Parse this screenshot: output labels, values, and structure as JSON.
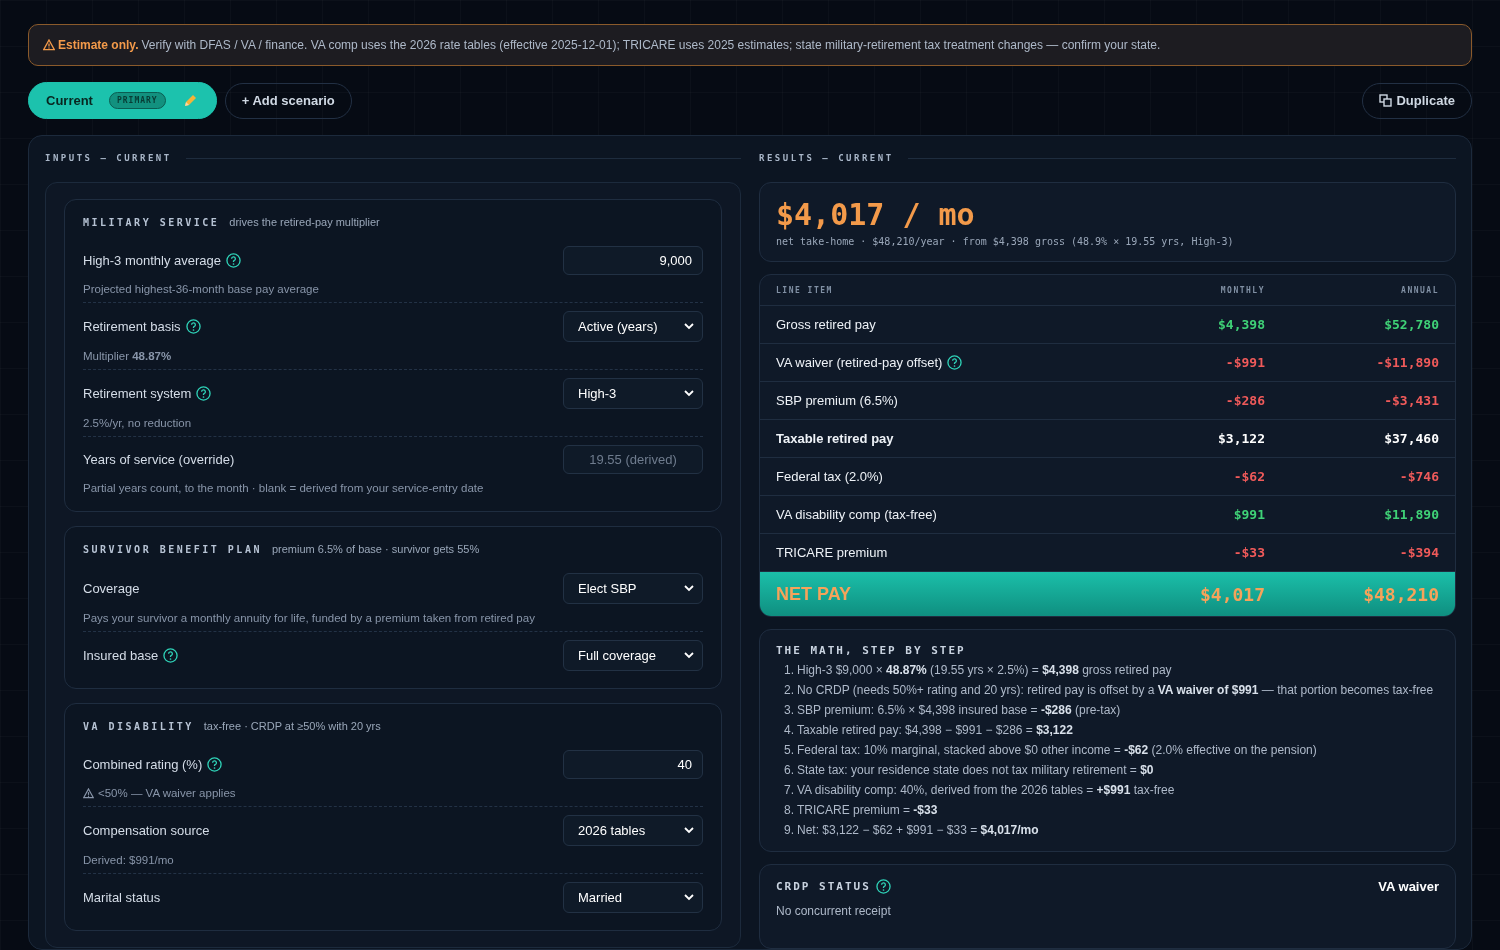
{
  "banner": {
    "lead": "Estimate only.",
    "text": "Verify with DFAS / VA / finance. VA comp uses the 2026 rate tables (effective 2025-12-01); TRICARE uses 2025 estimates; state military-retirement tax treatment changes — confirm your state."
  },
  "scenarios": [
    {
      "label": "Current",
      "badge": "PRIMARY",
      "selected": true
    }
  ],
  "add_scenario": "+ Add scenario",
  "duplicate": "Duplicate",
  "inputs_heading": "INPUTS — CURRENT",
  "results_heading": "RESULTS — CURRENT",
  "sections": [
    {
      "title": "MILITARY SERVICE",
      "subtitle": "drives the retired-pay multiplier",
      "fields": [
        {
          "label": "High-3 monthly average",
          "help": true,
          "kind": "number",
          "value": "9,000",
          "hint": "Projected highest-36-month base pay average"
        },
        {
          "label": "Retirement basis",
          "help": true,
          "kind": "select",
          "value": "Active (years)",
          "hint": "Multiplier **48.87%**"
        },
        {
          "label": "Retirement system",
          "help": true,
          "kind": "select",
          "value": "High-3",
          "hint": "2.5%/yr, no reduction"
        },
        {
          "label": "Years of service (override)",
          "help": false,
          "kind": "readonly",
          "placeholder": "19.55 (derived)",
          "hint": "Partial years count, to the month · blank = derived from your service-entry date"
        }
      ]
    },
    {
      "title": "SURVIVOR BENEFIT PLAN",
      "subtitle": "premium 6.5% of base · survivor gets 55%",
      "fields": [
        {
          "label": "Coverage",
          "help": false,
          "kind": "select",
          "value": "Elect SBP",
          "hint": "Pays your survivor a monthly annuity for life, funded by a premium taken from retired pay"
        },
        {
          "label": "Insured base",
          "help": true,
          "kind": "select",
          "value": "Full coverage"
        }
      ]
    },
    {
      "title": "VA DISABILITY",
      "subtitle": "tax-free · CRDP at ≥50% with 20 yrs",
      "fields": [
        {
          "label": "Combined rating (%)",
          "help": true,
          "kind": "number",
          "value": "40",
          "hint": "<50% — VA waiver applies",
          "warning": true
        },
        {
          "label": "Compensation source",
          "help": false,
          "kind": "select",
          "value": "2026 tables",
          "hint": "Derived: $991/mo"
        },
        {
          "label": "Marital status",
          "help": false,
          "kind": "select",
          "value": "Married"
        }
      ]
    }
  ],
  "summary": {
    "headline": "$4,017 / mo",
    "detail": "net take-home · $48,210/year · from $4,398 gross (48.9% × 19.55 yrs, High-3)"
  },
  "table": {
    "columns": [
      "LINE ITEM",
      "MONTHLY",
      "ANNUAL"
    ],
    "rows": [
      {
        "label": "Gross retired pay",
        "help": false,
        "bold": false,
        "color": "#3fd277",
        "monthly": "$4,398",
        "annual": "$52,780"
      },
      {
        "label": "VA waiver (retired-pay offset)",
        "help": true,
        "bold": false,
        "color": "#f05a5a",
        "monthly": "-$991",
        "annual": "-$11,890"
      },
      {
        "label": "SBP premium (6.5%)",
        "help": false,
        "bold": false,
        "color": "#f05a5a",
        "monthly": "-$286",
        "annual": "-$3,431"
      },
      {
        "label": "Taxable retired pay",
        "help": false,
        "bold": true,
        "color": "#ffffff",
        "monthly": "$3,122",
        "annual": "$37,460"
      },
      {
        "label": "Federal tax (2.0%)",
        "help": false,
        "bold": false,
        "color": "#f05a5a",
        "monthly": "-$62",
        "annual": "-$746"
      },
      {
        "label": "VA disability comp (tax-free)",
        "help": false,
        "bold": false,
        "color": "#3fd277",
        "monthly": "$991",
        "annual": "$11,890"
      },
      {
        "label": "TRICARE premium",
        "help": false,
        "bold": false,
        "color": "#f05a5a",
        "monthly": "-$33",
        "annual": "-$394"
      }
    ],
    "net": {
      "label": "NET PAY",
      "monthly": "$4,017",
      "annual": "$48,210"
    }
  },
  "math": {
    "title": "THE MATH, STEP BY STEP",
    "steps": [
      {
        "number": "1.",
        "text": "High-3 $9,000 × **48.87%** (19.55 yrs × 2.5%) = **$4,398** gross retired pay"
      },
      {
        "number": "2.",
        "text": "No CRDP (needs 50%+ rating and 20 yrs): retired pay is offset by a **VA waiver of $991** — that portion becomes tax-free"
      },
      {
        "number": "3.",
        "text": "SBP premium: 6.5% × $4,398 insured base = **-$286** (pre-tax)"
      },
      {
        "number": "4.",
        "text": "Taxable retired pay: $4,398 − $991 − $286 = **$3,122**"
      },
      {
        "number": "5.",
        "text": "Federal tax: 10% marginal, stacked above $0 other income = **-$62** (2.0% effective on the pension)"
      },
      {
        "number": "6.",
        "text": "State tax: your residence state does not tax military retirement = **$0**"
      },
      {
        "number": "7.",
        "text": "VA disability comp: 40%, derived from the 2026 tables = **+$991** tax-free"
      },
      {
        "number": "8.",
        "text": "TRICARE premium = **-$33**"
      },
      {
        "number": "9.",
        "text": "Net: $3,122 − $62 + $991 − $33 = **$4,017/mo**"
      }
    ]
  },
  "crdp": {
    "title": "CRDP STATUS",
    "help": true,
    "value": "VA waiver",
    "note": "No concurrent receipt"
  }
}
